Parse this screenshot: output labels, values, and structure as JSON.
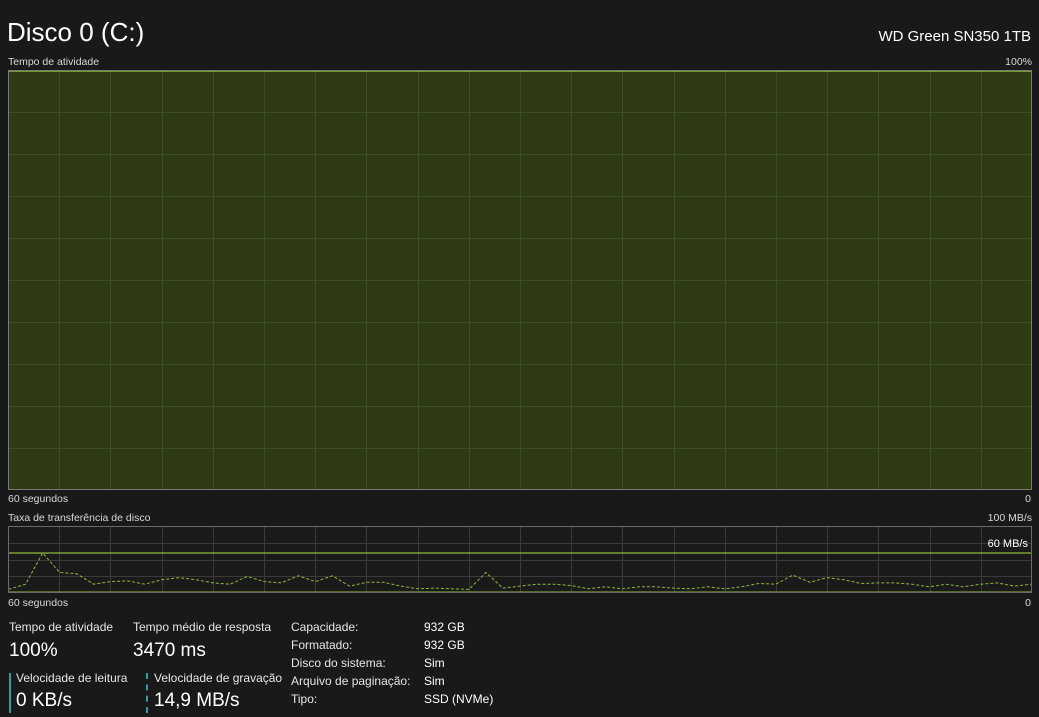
{
  "header": {
    "title": "Disco 0 (C:)",
    "model": "WD Green SN350 1TB"
  },
  "activity_graph": {
    "label": "Tempo de atividade",
    "max_label": "100%",
    "time_label": "60 segundos",
    "min_label": "0",
    "fill_color": "#2d3a12",
    "line_color": "#8fb83a",
    "grid_color": "#3f4f24",
    "values": [
      100,
      100,
      100,
      100,
      100,
      100,
      100,
      100,
      100,
      100,
      100,
      100,
      100,
      100,
      100,
      100,
      100,
      100,
      100,
      100,
      100,
      100,
      100,
      100,
      100,
      100,
      100,
      100,
      100,
      100,
      100,
      100,
      100,
      100,
      100,
      100,
      100,
      100,
      100,
      100,
      100,
      100,
      100,
      100,
      100,
      100,
      100,
      100,
      100,
      100,
      100,
      100,
      100,
      100,
      100,
      100,
      100,
      100,
      100,
      100,
      100
    ]
  },
  "transfer_graph": {
    "label": "Taxa de transferência de disco",
    "max_label": "100 MB/s",
    "threshold_label": "60 MB/s",
    "threshold_value": 60,
    "max_value": 100,
    "time_label": "60 segundos",
    "min_label": "0",
    "line_color": "#8fb83a",
    "grid_color": "#3a3a3a",
    "read_series": [
      0,
      0,
      0,
      0,
      0,
      0,
      0,
      0,
      0,
      0,
      0,
      0,
      0,
      0,
      0,
      0,
      0,
      0,
      0,
      0,
      0,
      0,
      0,
      0,
      0,
      0,
      0,
      0,
      0,
      0,
      0,
      0,
      0,
      0,
      0,
      0,
      0,
      0,
      0,
      0,
      0,
      0,
      0,
      0,
      0,
      0,
      0,
      0,
      0,
      0,
      0,
      0,
      0,
      0,
      0,
      0,
      0,
      0,
      0,
      0,
      0
    ],
    "write_series": [
      4,
      12,
      60,
      30,
      28,
      12,
      16,
      17,
      12,
      19,
      22,
      19,
      14,
      12,
      24,
      16,
      14,
      25,
      16,
      25,
      9,
      15,
      15,
      9,
      5,
      6,
      5,
      4,
      30,
      6,
      9,
      12,
      12,
      10,
      5,
      8,
      5,
      8,
      8,
      6,
      5,
      8,
      5,
      8,
      13,
      12,
      26,
      15,
      22,
      19,
      13,
      14,
      14,
      12,
      8,
      12,
      8,
      12,
      14,
      9,
      12
    ]
  },
  "stats": {
    "active_time_label": "Tempo de atividade",
    "active_time_value": "100%",
    "response_label": "Tempo médio de resposta",
    "response_value": "3470 ms",
    "read_label": "Velocidade de leitura",
    "read_value": "0 KB/s",
    "write_label": "Velocidade de gravação",
    "write_value": "14,9 MB/s"
  },
  "properties": [
    {
      "label": "Capacidade:",
      "value": "932 GB"
    },
    {
      "label": "Formatado:",
      "value": "932 GB"
    },
    {
      "label": "Disco do sistema:",
      "value": "Sim"
    },
    {
      "label": "Arquivo de paginação:",
      "value": "Sim"
    },
    {
      "label": "Tipo:",
      "value": "SSD (NVMe)"
    }
  ]
}
